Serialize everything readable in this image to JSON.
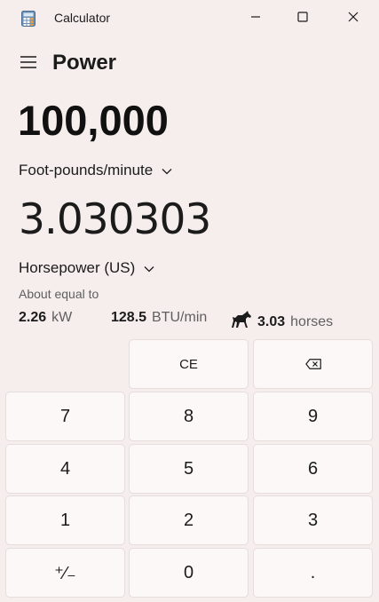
{
  "window": {
    "title": "Calculator",
    "icons": {
      "app": "calculator-icon",
      "minimize": "minimize-icon",
      "maximize": "maximize-icon",
      "close": "close-icon"
    }
  },
  "header": {
    "menu_icon": "hamburger-icon",
    "mode": "Power"
  },
  "converter": {
    "from": {
      "value": "100,000",
      "unit": "Foot-pounds/minute"
    },
    "to": {
      "value": "3.030303",
      "unit": "Horsepower (US)"
    },
    "about_label": "About equal to",
    "equivalents": [
      {
        "value": "2.26",
        "unit": "kW"
      },
      {
        "value": "128.5",
        "unit": "BTU/min"
      },
      {
        "value": "3.03",
        "unit": "horses",
        "icon": "horse-icon"
      }
    ]
  },
  "keypad": {
    "ce": "CE",
    "backspace_icon": "backspace-icon",
    "digits": {
      "0": "0",
      "1": "1",
      "2": "2",
      "3": "3",
      "4": "4",
      "5": "5",
      "6": "6",
      "7": "7",
      "8": "8",
      "9": "9"
    },
    "negate": "⁺⁄₋",
    "decimal": "."
  },
  "colors": {
    "background": "#f6eeec",
    "key": "#fbf8f7",
    "text": "#1b1b1b",
    "secondary_text": "#5f5f5f"
  }
}
